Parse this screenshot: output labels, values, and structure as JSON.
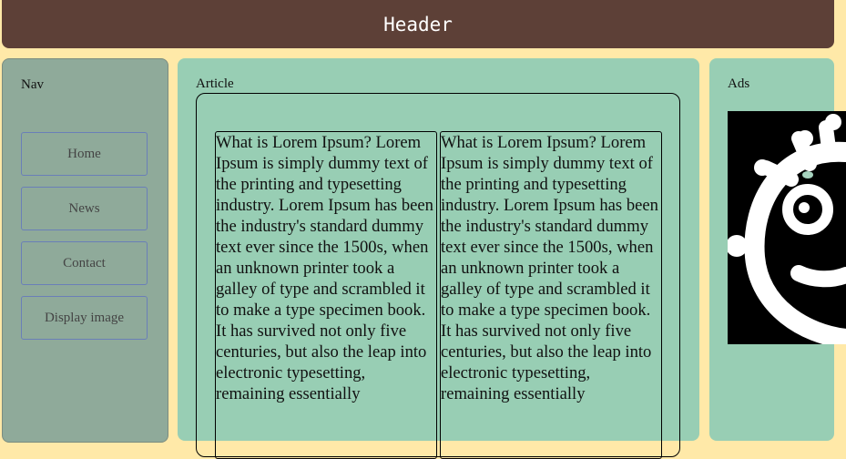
{
  "header": {
    "title": "Header"
  },
  "nav": {
    "label": "Nav",
    "items": [
      {
        "label": "Home"
      },
      {
        "label": "News"
      },
      {
        "label": "Contact"
      },
      {
        "label": "Display image"
      }
    ]
  },
  "article": {
    "label": "Article",
    "columns": [
      {
        "text": "What is Lorem Ipsum? Lorem Ipsum is simply dummy text of the printing and typesetting industry. Lorem Ipsum has been the industry's standard dummy text ever since the 1500s, when an unknown printer took a galley of type and scrambled it to make a type specimen book. It has survived not only five centuries, but also the leap into electronic typesetting, remaining essentially"
      },
      {
        "text": "What is Lorem Ipsum? Lorem Ipsum is simply dummy text of the printing and typesetting industry. Lorem Ipsum has been the industry's standard dummy text ever since the 1500s, when an unknown printer took a galley of type and scrambled it to make a type specimen book. It has survived not only five centuries, but also the leap into electronic typesetting, remaining essentially"
      }
    ]
  },
  "ads": {
    "label": "Ads",
    "image_icon": "cartoon-face-icon"
  },
  "colors": {
    "header_bg": "#5d4037",
    "page_bg": "#ffe9a8",
    "nav_bg": "#8faa9a",
    "panel_bg": "#98ceb4",
    "nav_button_border": "#6a7fb8"
  }
}
